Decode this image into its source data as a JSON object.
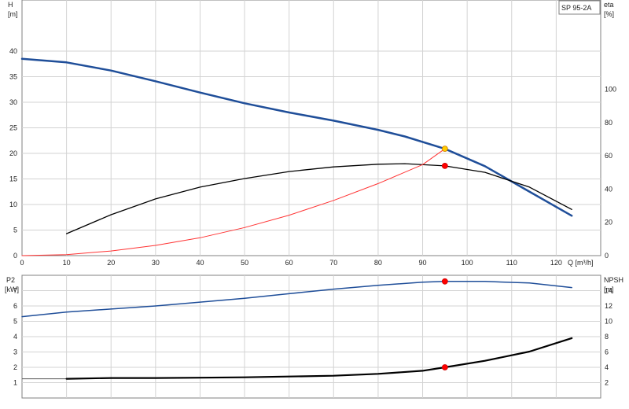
{
  "chart_data": [
    {
      "type": "line",
      "title": "SP 95-2A",
      "x_axis": {
        "label": "Q [m³/h]",
        "range": [
          0,
          130
        ],
        "ticks": [
          0,
          10,
          20,
          30,
          40,
          50,
          60,
          70,
          80,
          90,
          100,
          110,
          120
        ]
      },
      "y_left": {
        "label_line1": "H",
        "label_line2": "[m]",
        "range": [
          0,
          50
        ],
        "ticks": [
          0,
          5,
          10,
          15,
          20,
          25,
          30,
          35,
          40
        ]
      },
      "y_right": {
        "label_line1": "eta",
        "label_line2": "[%]",
        "range": [
          0,
          153.8
        ],
        "ticks": [
          0,
          20,
          40,
          60,
          80,
          100
        ]
      },
      "grid": true,
      "series": [
        {
          "key": "head",
          "axis": "left",
          "color": "#1f4e99",
          "width": 2.5,
          "x": [
            0,
            10,
            20,
            30,
            40,
            50,
            60,
            70,
            80,
            86,
            95,
            104,
            113,
            123.5
          ],
          "values": [
            38.5,
            37.8,
            36.2,
            34.1,
            31.9,
            29.8,
            28.0,
            26.4,
            24.6,
            23.3,
            20.9,
            17.5,
            13.0,
            7.8
          ]
        },
        {
          "key": "efficiency",
          "axis": "right",
          "color": "#000000",
          "width": 1.3,
          "x": [
            10,
            20,
            30,
            40,
            50,
            60,
            70,
            80,
            86,
            95,
            104,
            114,
            123.5
          ],
          "values": [
            13.2,
            24.6,
            34.1,
            41.2,
            46.4,
            50.6,
            53.4,
            55.0,
            55.3,
            54.0,
            50.1,
            41.2,
            27.8
          ]
        },
        {
          "key": "system_curve",
          "axis": "left",
          "color": "#ff3333",
          "width": 1,
          "x": [
            0,
            10,
            20,
            30,
            40,
            50,
            60,
            70,
            80,
            90,
            95
          ],
          "values": [
            0,
            0.2,
            0.9,
            2.0,
            3.5,
            5.5,
            7.9,
            10.8,
            14.1,
            17.8,
            20.9
          ]
        }
      ],
      "markers": [
        {
          "axis": "left",
          "x": 95,
          "y": 20.9,
          "color": "#ffcc00",
          "stroke": "#cc7a00"
        },
        {
          "axis": "right",
          "x": 95,
          "y": 54.0,
          "color": "#ff0000",
          "stroke": "#cc0000"
        }
      ]
    },
    {
      "type": "line",
      "x_axis": {
        "range": [
          0,
          130
        ]
      },
      "y_left": {
        "label_line1": "P2",
        "label_line2": "[kW]",
        "range": [
          0,
          8
        ],
        "ticks": [
          1,
          2,
          3,
          4,
          5,
          6,
          7
        ]
      },
      "y_right": {
        "label_line1": "NPSH",
        "label_line2": "[m]",
        "range": [
          0,
          16
        ],
        "ticks": [
          2,
          4,
          6,
          8,
          10,
          12,
          14
        ]
      },
      "grid": true,
      "series": [
        {
          "key": "power",
          "axis": "left",
          "color": "#1f4e99",
          "width": 1.5,
          "x": [
            0,
            10,
            20,
            30,
            40,
            50,
            60,
            70,
            80,
            90,
            95,
            104,
            114,
            123.5
          ],
          "values": [
            5.3,
            5.6,
            5.8,
            6.0,
            6.25,
            6.5,
            6.8,
            7.1,
            7.35,
            7.55,
            7.6,
            7.6,
            7.5,
            7.2
          ]
        },
        {
          "key": "npsh",
          "axis": "right",
          "color": "#000000",
          "width": 2.2,
          "x": [
            10,
            20,
            30,
            40,
            50,
            60,
            70,
            80,
            90,
            95,
            104,
            114,
            123.5
          ],
          "values": [
            2.5,
            2.6,
            2.6,
            2.65,
            2.7,
            2.8,
            2.9,
            3.15,
            3.55,
            4.0,
            4.85,
            6.05,
            7.8
          ]
        }
      ],
      "flat_line": {
        "axis": "left",
        "x": [
          0,
          10
        ],
        "y": 1.25,
        "color": "#555555"
      },
      "markers": [
        {
          "axis": "left",
          "x": 95,
          "y": 7.6,
          "color": "#ff0000",
          "stroke": "#cc0000"
        },
        {
          "axis": "right",
          "x": 95,
          "y": 4.0,
          "color": "#ff0000",
          "stroke": "#cc0000"
        }
      ]
    }
  ]
}
